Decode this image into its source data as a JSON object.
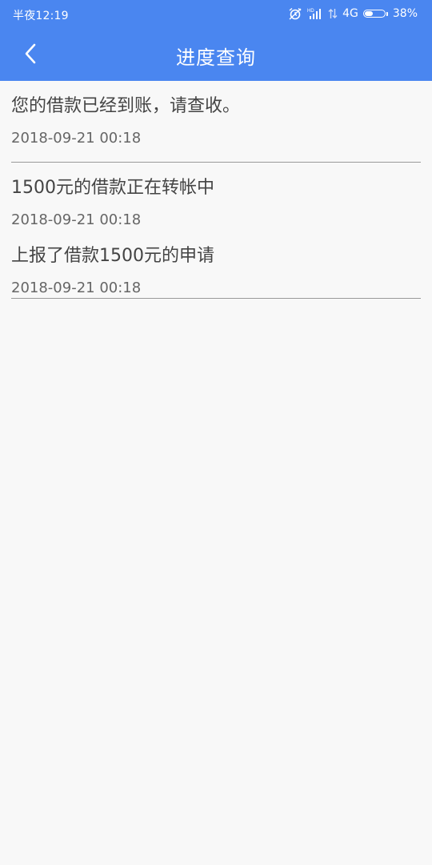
{
  "status_bar": {
    "time": "半夜12:19",
    "network": "4G",
    "battery": "38%",
    "battery_level": 0.38
  },
  "header": {
    "title": "进度查询",
    "back_icon": "chevron-left-icon"
  },
  "colors": {
    "primary": "#4a86f0",
    "background": "#f8f8f8",
    "text": "#444444",
    "divider": "#9a9a9a"
  },
  "records": [
    {
      "message": "您的借款已经到账，请查收。",
      "date": "2018-09-21 00:18"
    },
    {
      "message": "1500元的借款正在转帐中",
      "date": "2018-09-21 00:18"
    },
    {
      "message": "上报了借款1500元的申请",
      "date": "2018-09-21 00:18"
    }
  ]
}
